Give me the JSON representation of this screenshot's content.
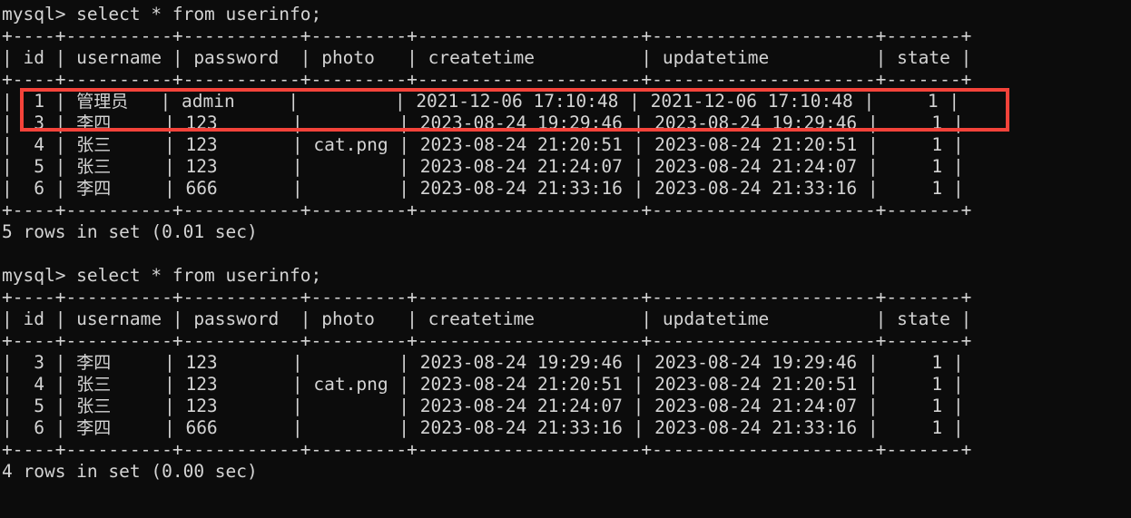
{
  "terminal": {
    "background_color": "#0c0c0c",
    "text_color": "#d4d4d4",
    "highlight_color": "#f4433a",
    "prompt": "mysql>"
  },
  "sessions": [
    {
      "command_line": "mysql> select * from userinfo;",
      "border_top": "+----+----------+-----------+---------+---------------------+---------------------+-------+",
      "header_line": "| id | username | password | photo   | createtime          | updatetime          | state |",
      "border_mid": "+----+----------+-----------+---------+---------------------+---------------------+-------+",
      "border_bottom": "+----+----------+-----------+---------+---------------------+---------------------+-------+",
      "columns": [
        "id",
        "username",
        "password",
        "photo",
        "createtime",
        "updatetime",
        "state"
      ],
      "rows": [
        {
          "id": "1",
          "username": "管理员",
          "password": "admin",
          "photo": "",
          "createtime": "2021-12-06 17:10:48",
          "updatetime": "2021-12-06 17:10:48",
          "state": "1",
          "highlighted": true
        },
        {
          "id": "3",
          "username": "李四",
          "password": "123",
          "photo": "",
          "createtime": "2023-08-24 19:29:46",
          "updatetime": "2023-08-24 19:29:46",
          "state": "1",
          "highlighted": false
        },
        {
          "id": "4",
          "username": "张三",
          "password": "123",
          "photo": "cat.png",
          "createtime": "2023-08-24 21:20:51",
          "updatetime": "2023-08-24 21:20:51",
          "state": "1",
          "highlighted": false
        },
        {
          "id": "5",
          "username": "张三",
          "password": "123",
          "photo": "",
          "createtime": "2023-08-24 21:24:07",
          "updatetime": "2023-08-24 21:24:07",
          "state": "1",
          "highlighted": false
        },
        {
          "id": "6",
          "username": "李四",
          "password": "666",
          "photo": "",
          "createtime": "2023-08-24 21:33:16",
          "updatetime": "2023-08-24 21:33:16",
          "state": "1",
          "highlighted": false
        }
      ],
      "result_line": "5 rows in set (0.01 sec)"
    },
    {
      "command_line": "mysql> select * from userinfo;",
      "border_top": "+----+----------+-----------+---------+---------------------+---------------------+-------+",
      "header_line": "| id | username | password | photo   | createtime          | updatetime          | state |",
      "border_mid": "+----+----------+-----------+---------+---------------------+---------------------+-------+",
      "border_bottom": "+----+----------+-----------+---------+---------------------+---------------------+-------+",
      "columns": [
        "id",
        "username",
        "password",
        "photo",
        "createtime",
        "updatetime",
        "state"
      ],
      "rows": [
        {
          "id": "3",
          "username": "李四",
          "password": "123",
          "photo": "",
          "createtime": "2023-08-24 19:29:46",
          "updatetime": "2023-08-24 19:29:46",
          "state": "1",
          "highlighted": false
        },
        {
          "id": "4",
          "username": "张三",
          "password": "123",
          "photo": "cat.png",
          "createtime": "2023-08-24 21:20:51",
          "updatetime": "2023-08-24 21:20:51",
          "state": "1",
          "highlighted": false
        },
        {
          "id": "5",
          "username": "张三",
          "password": "123",
          "photo": "",
          "createtime": "2023-08-24 21:24:07",
          "updatetime": "2023-08-24 21:24:07",
          "state": "1",
          "highlighted": false
        },
        {
          "id": "6",
          "username": "李四",
          "password": "666",
          "photo": "",
          "createtime": "2023-08-24 21:33:16",
          "updatetime": "2023-08-24 21:33:16",
          "state": "1",
          "highlighted": false
        }
      ],
      "result_line": "4 rows in set (0.00 sec)"
    }
  ],
  "annotation": {
    "type": "rectangle-highlight",
    "target_row_id": "1",
    "color": "#f4433a"
  }
}
